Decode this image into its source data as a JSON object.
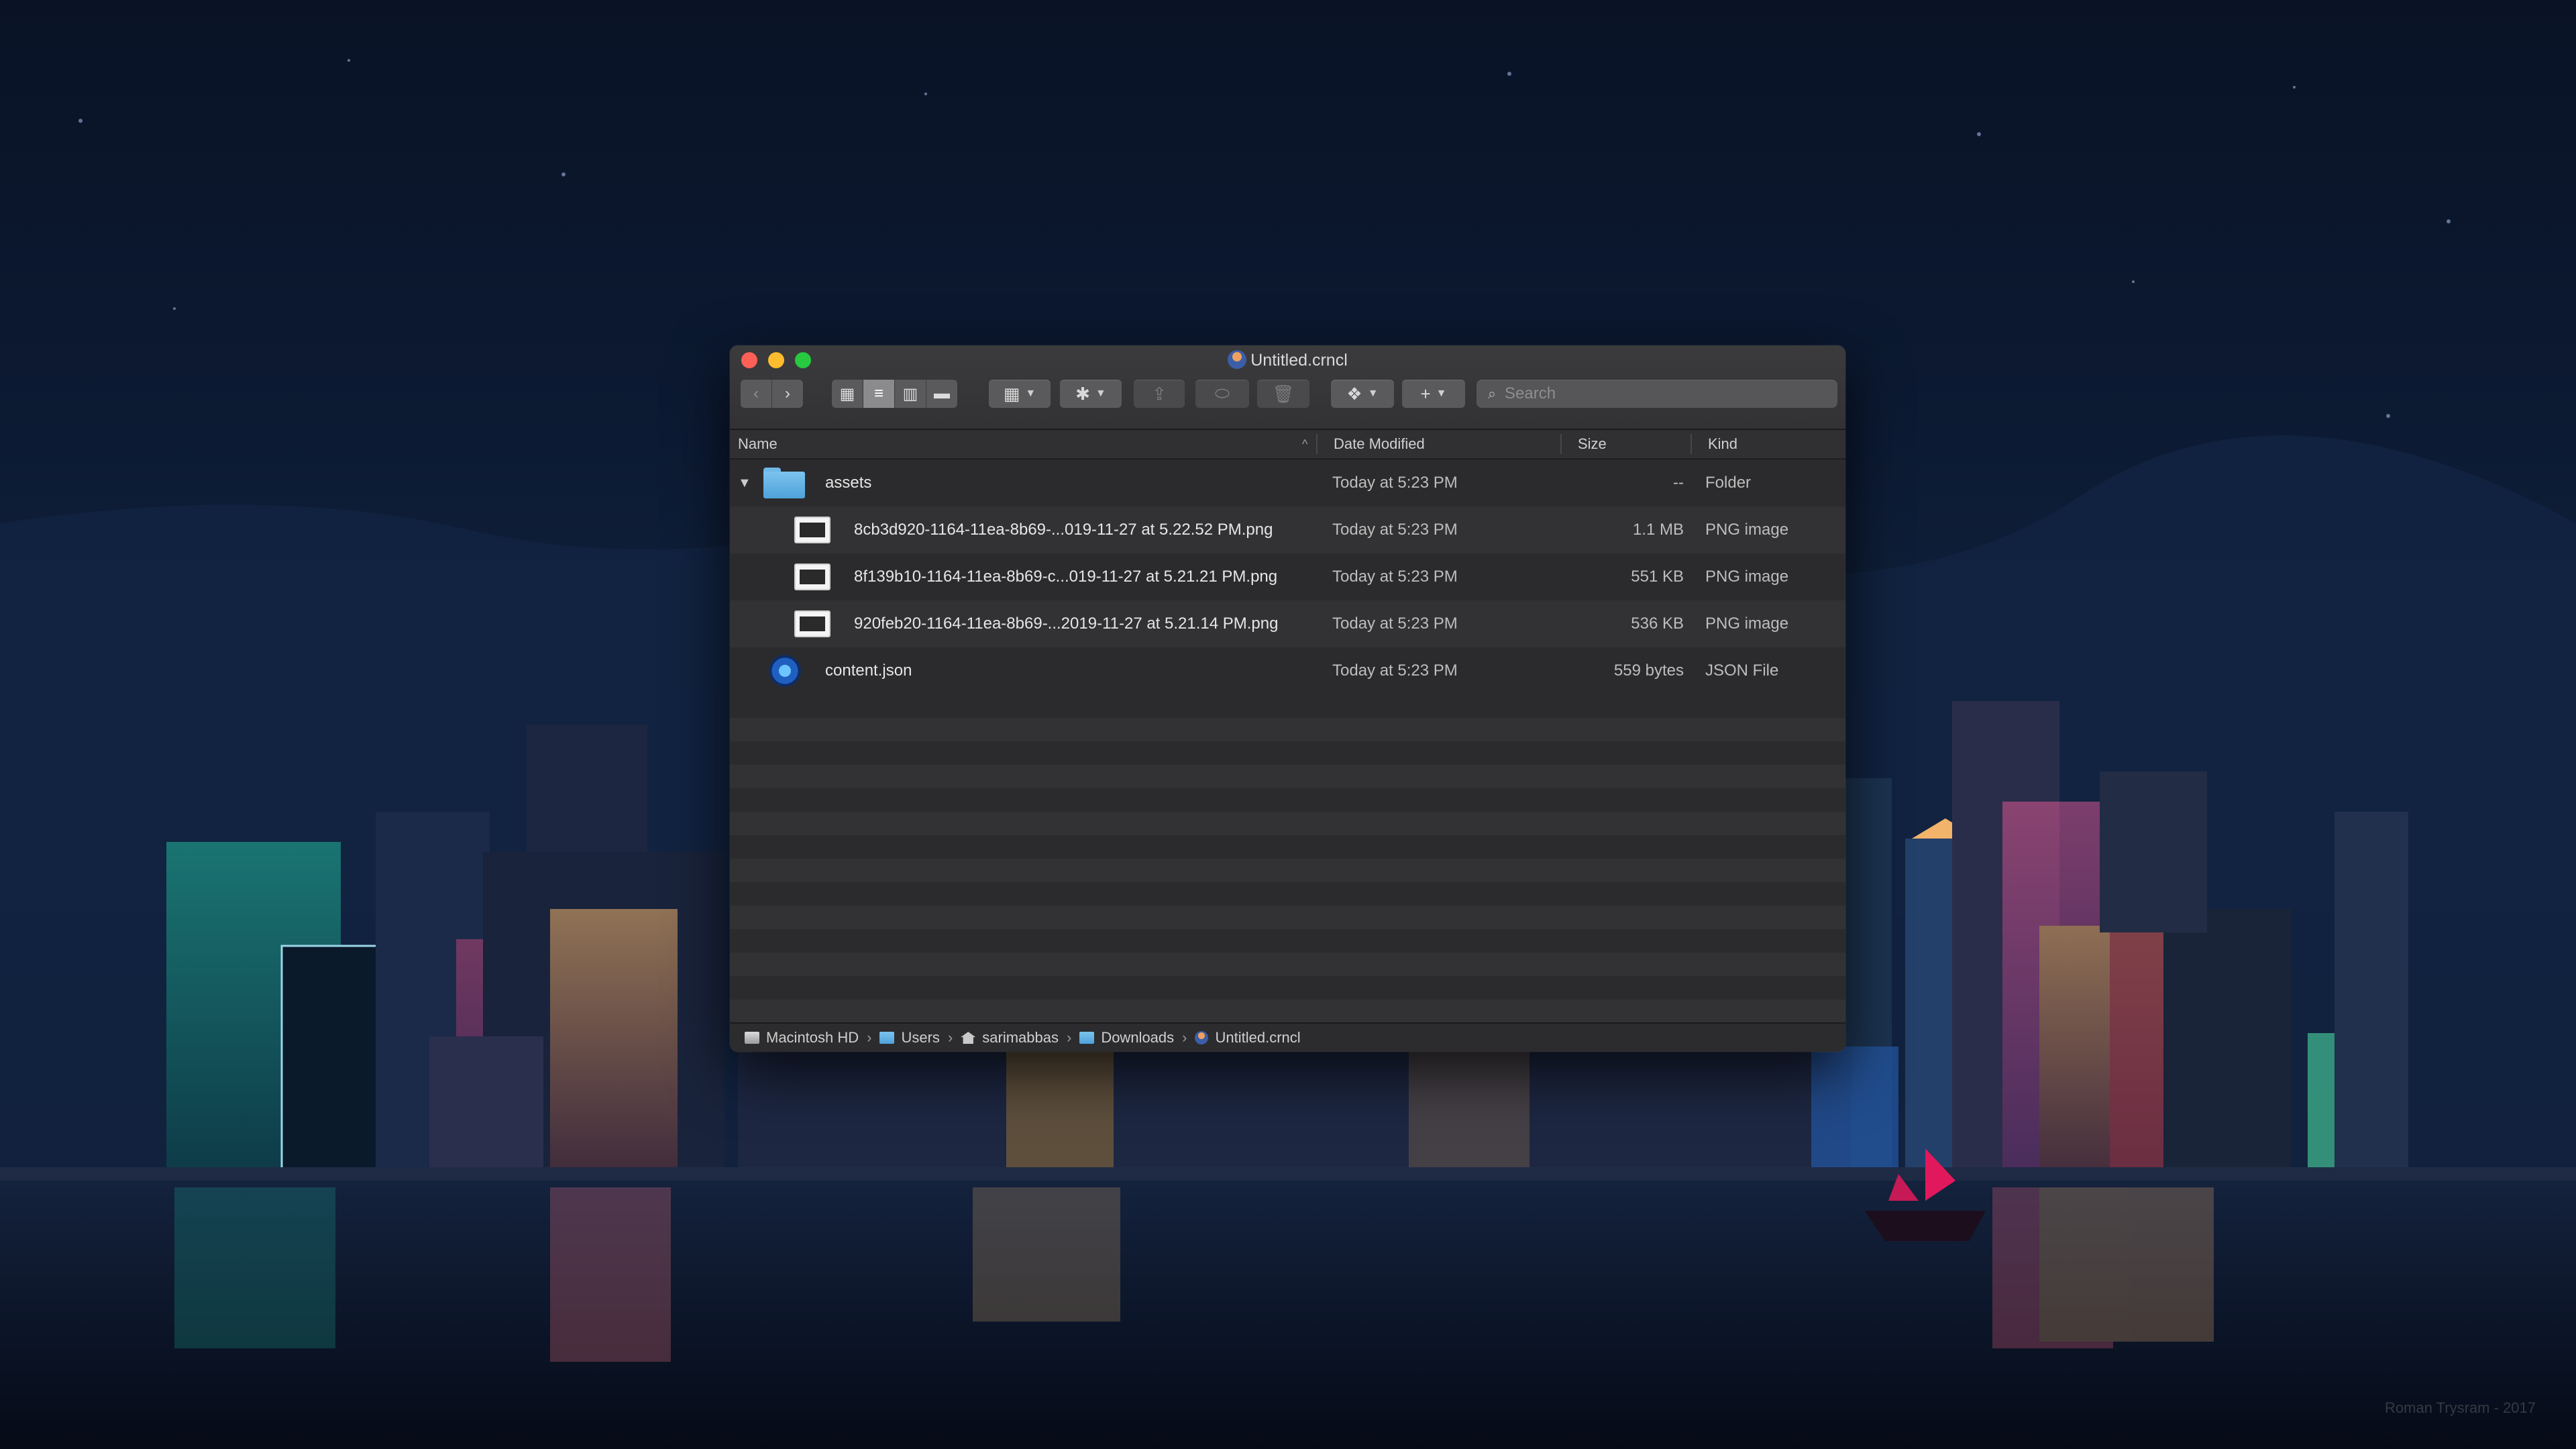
{
  "window": {
    "title": "Untitled.crncl"
  },
  "toolbar": {
    "back": "‹",
    "forward": "›",
    "view_icons": "▦",
    "view_list": "≡",
    "view_columns": "▥",
    "view_gallery": "▬",
    "group": "▦",
    "action": "✱",
    "share": "⇪",
    "tag": "⬭",
    "trash": "🗑",
    "dropbox": "❖",
    "add": "+",
    "search_placeholder": "Search"
  },
  "columns": {
    "name": "Name",
    "date": "Date Modified",
    "size": "Size",
    "kind": "Kind",
    "sort_indicator": "^"
  },
  "rows": [
    {
      "name": "assets",
      "date": "Today at 5:23 PM",
      "size": "--",
      "kind": "Folder",
      "icon": "folder-icon",
      "expanded": true
    },
    {
      "name": "8cb3d920-1164-11ea-8b69-...019-11-27 at 5.22.52 PM.png",
      "date": "Today at 5:23 PM",
      "size": "1.1 MB",
      "kind": "PNG image",
      "icon": "png-file-icon"
    },
    {
      "name": "8f139b10-1164-11ea-8b69-c...019-11-27 at 5.21.21 PM.png",
      "date": "Today at 5:23 PM",
      "size": "551 KB",
      "kind": "PNG image",
      "icon": "png-file-icon"
    },
    {
      "name": "920feb20-1164-11ea-8b69-...2019-11-27 at 5.21.14 PM.png",
      "date": "Today at 5:23 PM",
      "size": "536 KB",
      "kind": "PNG image",
      "icon": "png-file-icon"
    },
    {
      "name": "content.json",
      "date": "Today at 5:23 PM",
      "size": "559 bytes",
      "kind": "JSON File",
      "icon": "json-file-icon"
    }
  ],
  "pathbar": [
    {
      "label": "Macintosh HD",
      "icon": "disk-icon"
    },
    {
      "label": "Users",
      "icon": "folder-icon"
    },
    {
      "label": "sarimabbas",
      "icon": "home-icon"
    },
    {
      "label": "Downloads",
      "icon": "folder-icon"
    },
    {
      "label": "Untitled.crncl",
      "icon": "crncl-icon"
    }
  ],
  "wallpaper": {
    "watermark": "Roman Trysram - 2017"
  },
  "colors": {
    "close": "#fe5f57",
    "minimize": "#febc2e",
    "maximize": "#28c840",
    "folder_blue": "#5aacdf",
    "window_bg": "#2b2b2d"
  }
}
